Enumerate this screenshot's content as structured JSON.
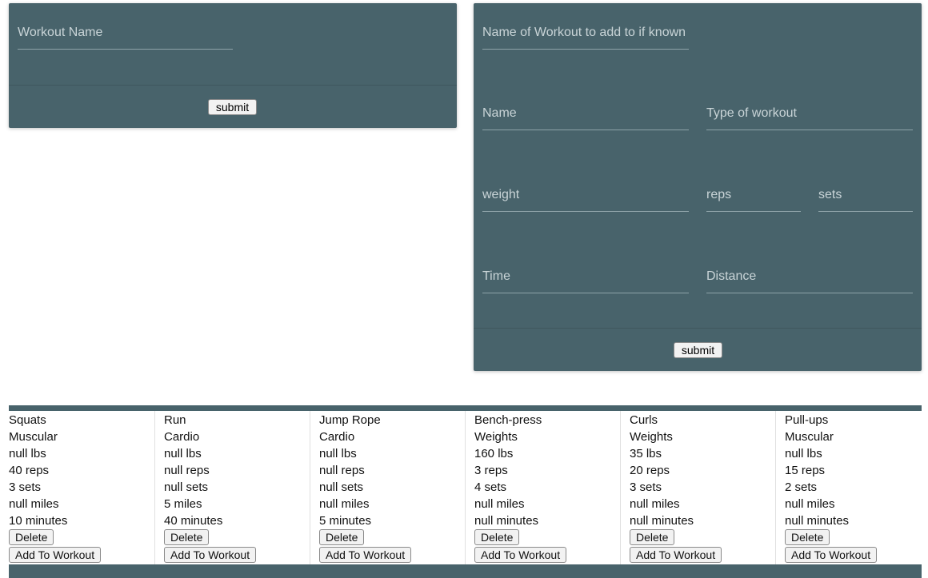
{
  "workout_form": {
    "name_placeholder": "Workout Name",
    "submit_label": "submit"
  },
  "exercise_form": {
    "workout_name_placeholder": "Name of Workout to add to if known",
    "name_placeholder": "Name",
    "type_placeholder": "Type of workout",
    "weight_placeholder": "weight",
    "reps_placeholder": "reps",
    "sets_placeholder": "sets",
    "time_placeholder": "Time",
    "distance_placeholder": "Distance",
    "submit_label": "submit"
  },
  "exercises": [
    {
      "name": "Squats",
      "type": "Muscular",
      "weight": "null lbs",
      "reps": "40 reps",
      "sets": "3 sets",
      "distance": "null miles",
      "time": "10 minutes",
      "delete_label": "Delete",
      "add_label": "Add To Workout"
    },
    {
      "name": "Run",
      "type": "Cardio",
      "weight": "null lbs",
      "reps": "null reps",
      "sets": "null sets",
      "distance": "5 miles",
      "time": "40 minutes",
      "delete_label": "Delete",
      "add_label": "Add To Workout"
    },
    {
      "name": "Jump Rope",
      "type": "Cardio",
      "weight": "null lbs",
      "reps": "null reps",
      "sets": "null sets",
      "distance": "null miles",
      "time": "5 minutes",
      "delete_label": "Delete",
      "add_label": "Add To Workout"
    },
    {
      "name": "Bench-press",
      "type": "Weights",
      "weight": "160 lbs",
      "reps": "3 reps",
      "sets": "4 sets",
      "distance": "null miles",
      "time": "null minutes",
      "delete_label": "Delete",
      "add_label": "Add To Workout"
    },
    {
      "name": "Curls",
      "type": "Weights",
      "weight": "35 lbs",
      "reps": "20 reps",
      "sets": "3 sets",
      "distance": "null miles",
      "time": "null minutes",
      "delete_label": "Delete",
      "add_label": "Add To Workout"
    },
    {
      "name": "Pull-ups",
      "type": "Muscular",
      "weight": "null lbs",
      "reps": "15 reps",
      "sets": "2 sets",
      "distance": "null miles",
      "time": "null minutes",
      "delete_label": "Delete",
      "add_label": "Add To Workout"
    }
  ],
  "colors": {
    "panel": "#48636b",
    "placeholder": "#c9d4d7"
  }
}
